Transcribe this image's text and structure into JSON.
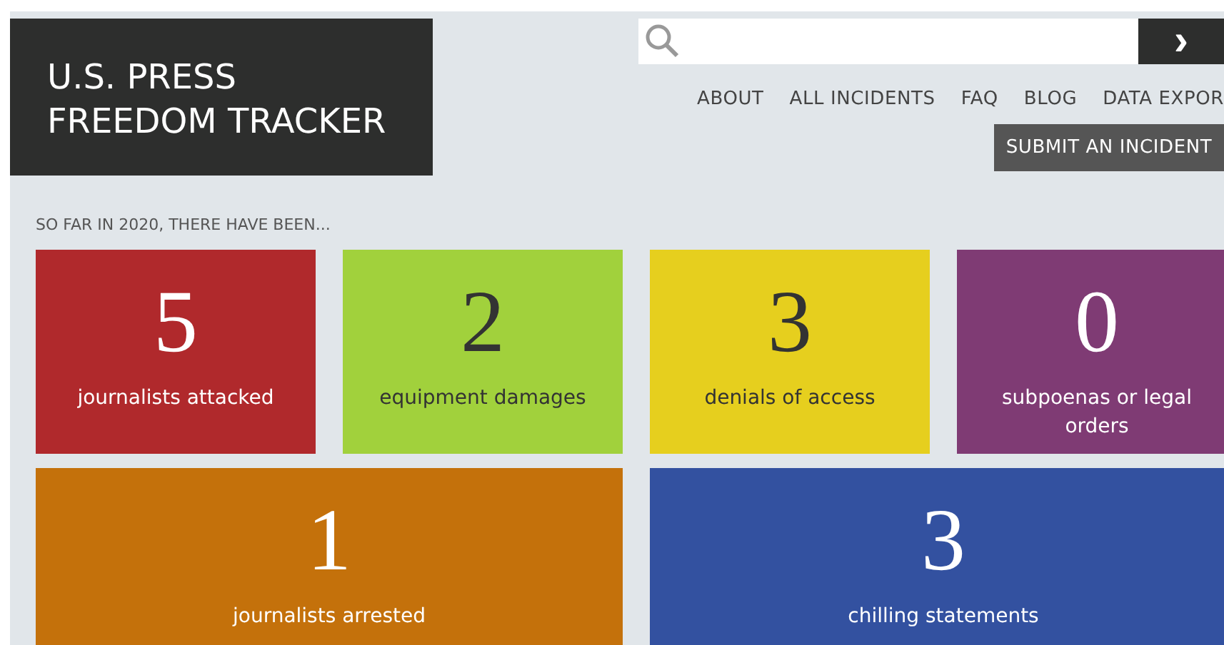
{
  "logo": {
    "lines": [
      "U.S. PRESS",
      "FREEDOM TRACKER"
    ]
  },
  "search": {
    "submit": "›"
  },
  "nav": [
    {
      "label": "ABOUT"
    },
    {
      "label": "ALL INCIDENTS"
    },
    {
      "label": "FAQ"
    },
    {
      "label": "BLOG"
    },
    {
      "label": "DATA EXPOR"
    }
  ],
  "submit_button": "SUBMIT AN INCIDENT",
  "intro": "SO FAR IN 2020, THERE HAVE BEEN...",
  "tiles": [
    {
      "kind": "small",
      "count": "5",
      "label": "journalists attacked",
      "color": "#b0292c"
    },
    {
      "kind": "small",
      "count": "2",
      "label": "equipment damages",
      "color": "#a1d13c"
    },
    {
      "kind": "small",
      "count": "3",
      "label": "denials of access",
      "color": "#e6cf1e"
    },
    {
      "kind": "small",
      "count": "0",
      "label": "subpoenas or legal orders",
      "color": "#7f3b74"
    },
    {
      "kind": "wide",
      "count": "1",
      "label": "journalists arrested",
      "color": "#c4710b"
    },
    {
      "kind": "wide",
      "count": "3",
      "label": "chilling statements",
      "color": "#3351a0"
    }
  ]
}
